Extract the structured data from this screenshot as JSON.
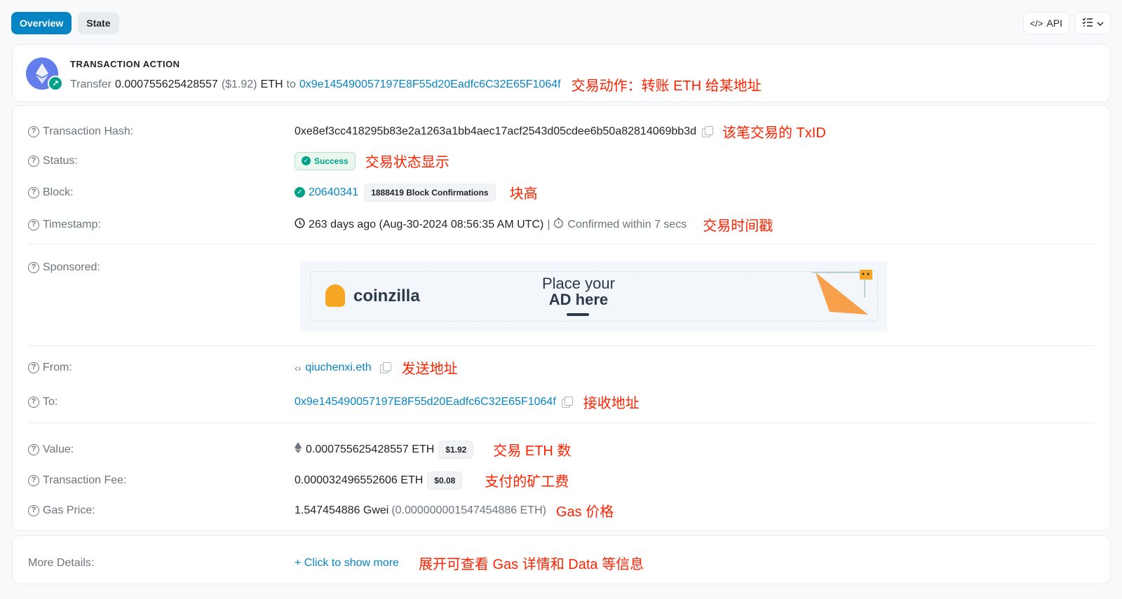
{
  "tabs": {
    "overview": "Overview",
    "state": "State"
  },
  "toolbar": {
    "api_label": "API"
  },
  "transaction_action": {
    "title": "TRANSACTION ACTION",
    "verb": "Transfer",
    "amount": "0.000755625428557",
    "usd": "($1.92)",
    "unit": "ETH",
    "to_word": "to",
    "to_address": "0x9e145490057197E8F55d20Eadfc6C32E65F1064f",
    "annotation": "交易动作：转账 ETH 给某地址"
  },
  "fields": {
    "tx_hash": {
      "label": "Transaction Hash:",
      "value": "0xe8ef3cc418295b83e2a1263a1bb4aec17acf2543d05cdee6b50a82814069bb3d",
      "annotation": "该笔交易的 TxID"
    },
    "status": {
      "label": "Status:",
      "value": "Success",
      "annotation": "交易状态显示"
    },
    "block": {
      "label": "Block:",
      "value": "20640341",
      "confirmations": "1888419 Block Confirmations",
      "annotation": "块高"
    },
    "timestamp": {
      "label": "Timestamp:",
      "value": "263 days ago (Aug-30-2024 08:56:35 AM UTC)",
      "separator": "|",
      "confirmed": "Confirmed within 7 secs",
      "annotation": "交易时间戳"
    },
    "sponsored": {
      "label": "Sponsored:",
      "ad_brand": "coinzilla",
      "ad_line1": "Place your",
      "ad_line2": "AD here"
    },
    "from": {
      "label": "From:",
      "value": "qiuchenxi.eth",
      "annotation": "发送地址"
    },
    "to": {
      "label": "To:",
      "value": "0x9e145490057197E8F55d20Eadfc6C32E65F1064f",
      "annotation": "接收地址"
    },
    "value": {
      "label": "Value:",
      "value": "0.000755625428557 ETH",
      "usd": "$1.92",
      "annotation": "交易 ETH 数"
    },
    "fee": {
      "label": "Transaction Fee:",
      "value": "0.000032496552606 ETH",
      "usd": "$0.08",
      "annotation": "支付的矿工费"
    },
    "gas_price": {
      "label": "Gas Price:",
      "value": "1.547454886 Gwei",
      "eth": "(0.000000001547454886 ETH)",
      "annotation": "Gas 价格"
    }
  },
  "more_details": {
    "label": "More Details:",
    "action": "+ Click to show more",
    "annotation": "展开可查看 Gas 详情和 Data 等信息"
  },
  "colors": {
    "link": "#0784c3",
    "success": "#00a186",
    "annotation": "#ff2200",
    "eth": "#627eea"
  }
}
